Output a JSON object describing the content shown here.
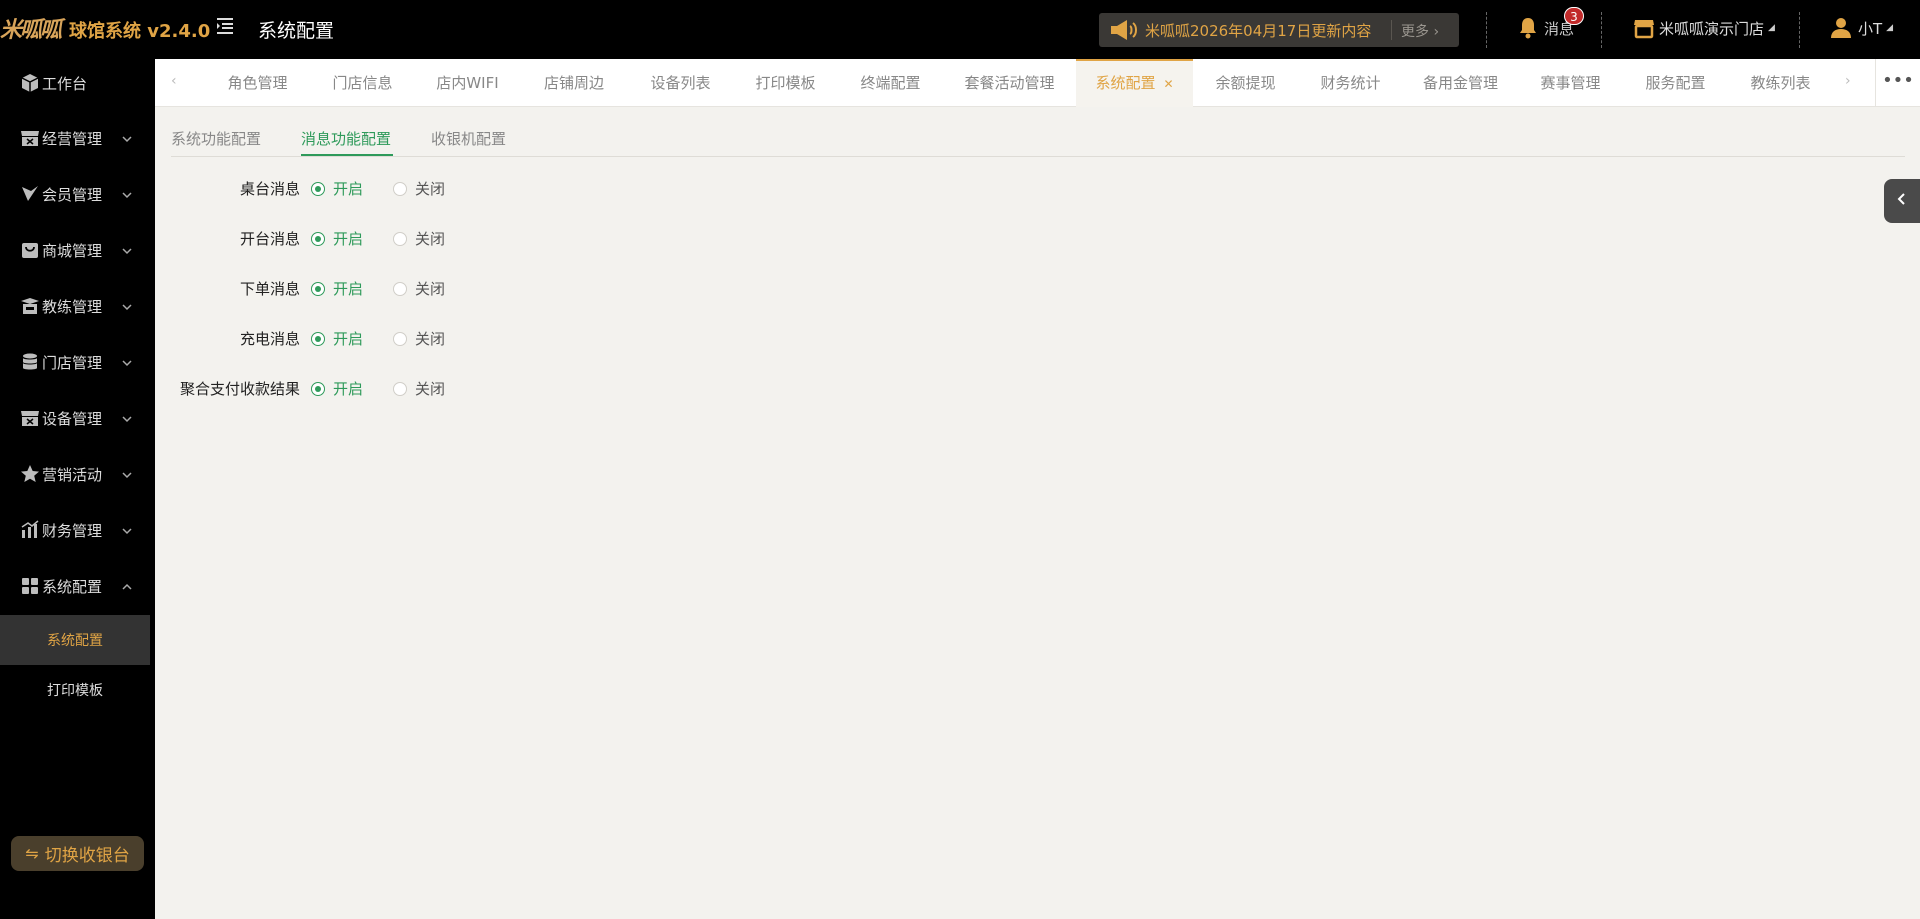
{
  "header": {
    "logo_text": "米呱呱",
    "brand": "球馆系统 v2.4.0",
    "page_title": "系统配置",
    "notice_text": "米呱呱2026年04月17日更新内容",
    "notice_more": "更多",
    "messages_label": "消息",
    "messages_count": "3",
    "store_name": "米呱呱演示门店",
    "user_name": "小T"
  },
  "sidebar": {
    "items": [
      {
        "label": "工作台",
        "icon": "cube-icon"
      },
      {
        "label": "经营管理",
        "icon": "store-icon"
      },
      {
        "label": "会员管理",
        "icon": "v-icon"
      },
      {
        "label": "商城管理",
        "icon": "bag-icon"
      },
      {
        "label": "教练管理",
        "icon": "coach-icon"
      },
      {
        "label": "门店管理",
        "icon": "database-icon"
      },
      {
        "label": "设备管理",
        "icon": "device-icon"
      },
      {
        "label": "营销活动",
        "icon": "star-icon"
      },
      {
        "label": "财务管理",
        "icon": "chart-icon"
      },
      {
        "label": "系统配置",
        "icon": "grid-icon"
      }
    ],
    "sub_items": [
      {
        "label": "系统配置",
        "active": true
      },
      {
        "label": "打印模板",
        "active": false
      }
    ],
    "switch_button": "切换收银台"
  },
  "tabs": [
    {
      "label": "角色管理"
    },
    {
      "label": "门店信息"
    },
    {
      "label": "店内WIFI"
    },
    {
      "label": "店铺周边"
    },
    {
      "label": "设备列表"
    },
    {
      "label": "打印模板"
    },
    {
      "label": "终端配置"
    },
    {
      "label": "套餐活动管理"
    },
    {
      "label": "系统配置",
      "active": true
    },
    {
      "label": "余额提现"
    },
    {
      "label": "财务统计"
    },
    {
      "label": "备用金管理"
    },
    {
      "label": "赛事管理"
    },
    {
      "label": "服务配置"
    },
    {
      "label": "教练列表"
    }
  ],
  "subtabs": [
    {
      "label": "系统功能配置"
    },
    {
      "label": "消息功能配置",
      "active": true
    },
    {
      "label": "收银机配置"
    }
  ],
  "settings": [
    {
      "label": "桌台消息",
      "on_label": "开启",
      "off_label": "关闭",
      "value": "on"
    },
    {
      "label": "开台消息",
      "on_label": "开启",
      "off_label": "关闭",
      "value": "on"
    },
    {
      "label": "下单消息",
      "on_label": "开启",
      "off_label": "关闭",
      "value": "on"
    },
    {
      "label": "充电消息",
      "on_label": "开启",
      "off_label": "关闭",
      "value": "on"
    },
    {
      "label": "聚合支付收款结果",
      "on_label": "开启",
      "off_label": "关闭",
      "value": "on"
    }
  ],
  "colors": {
    "accent": "#e0a445",
    "green": "#2e9a5a",
    "sidebar_bg": "#000000",
    "content_bg": "#f3f2ee"
  }
}
